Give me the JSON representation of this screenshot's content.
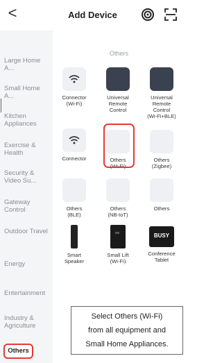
{
  "header": {
    "back_glyph": "<",
    "title": "Add Device",
    "icons": [
      "target-icon",
      "scan-icon"
    ]
  },
  "sidebar": {
    "items": [
      {
        "label": "Large Home A..."
      },
      {
        "label": "Small Home A..."
      },
      {
        "label": "Kitchen Appliances"
      },
      {
        "label": "Exercise & Health"
      },
      {
        "label": "Security & Video Su..."
      },
      {
        "label": "Gateway Control"
      },
      {
        "label": "Outdoor Travel"
      },
      {
        "label": "Energy"
      },
      {
        "label": "Entertainment"
      },
      {
        "label": "Industry & Agriculture"
      },
      {
        "label": "Others"
      }
    ],
    "active": "Others"
  },
  "main": {
    "section_title": "Others",
    "tiles": [
      {
        "label": "Connector\n(Wi-Fi)",
        "icon": "wifi-icon"
      },
      {
        "label": "Universal\nRemote\nControl",
        "icon": "remote-icon"
      },
      {
        "label": "Universal\nRemote\nControl\n(Wi-Fi+BLE)",
        "icon": "remote-icon"
      },
      {
        "label": "Connector",
        "icon": "wifi-icon"
      },
      {
        "label": "Others\n(Wi-Fi)",
        "icon": "device-icon"
      },
      {
        "label": "Others\n(Zigbee)",
        "icon": "device-icon"
      },
      {
        "label": "Others\n(BLE)",
        "icon": "device-icon"
      },
      {
        "label": "Others\n(NB-IoT)",
        "icon": "device-icon"
      },
      {
        "label": "Others",
        "icon": "device-icon"
      },
      {
        "label": "Smart\nSpeaker",
        "icon": "speaker-icon"
      },
      {
        "label": "Small Lift\n(Wi-Fi)",
        "icon": "lift-icon"
      },
      {
        "label": "Conference\nTablet",
        "icon": "busy-tablet-icon",
        "badge": "BUSY"
      }
    ]
  },
  "annotation": {
    "lines": [
      "Select Others (Wi-Fi)",
      "from all equipment and",
      "Small Home Appliances."
    ],
    "highlight_color": "#e53935"
  }
}
